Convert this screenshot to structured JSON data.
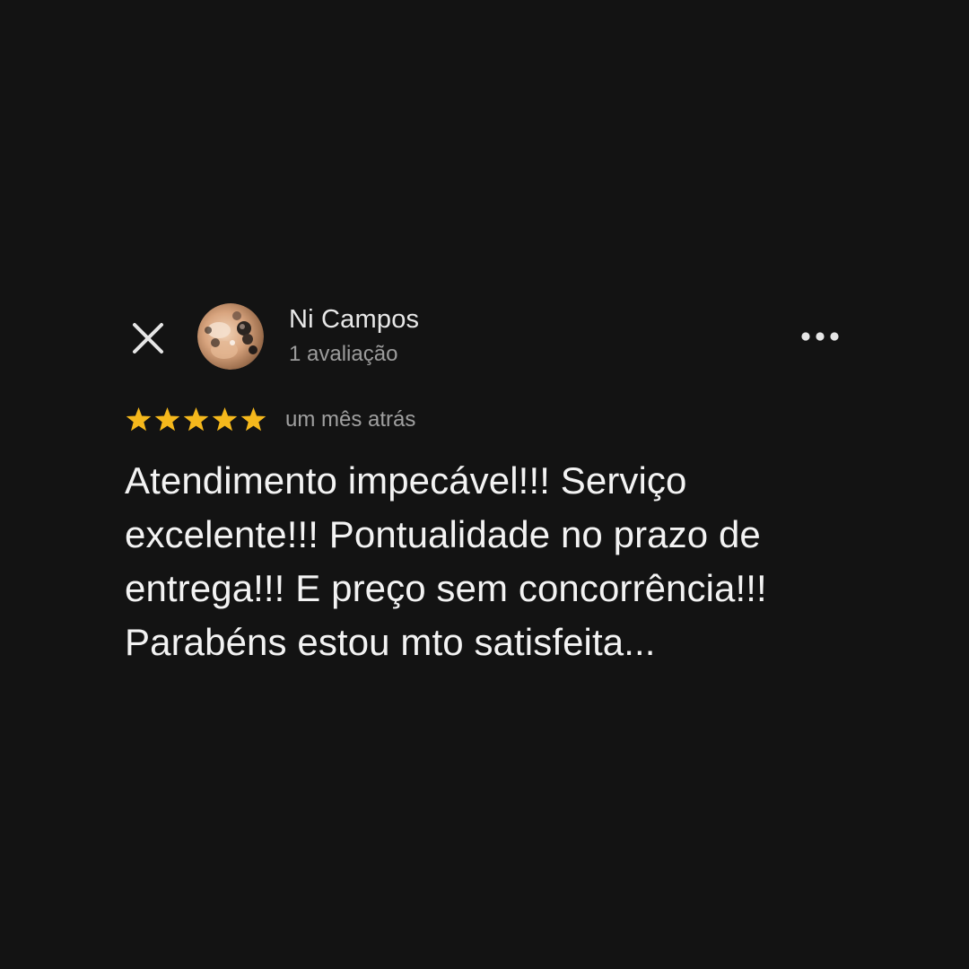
{
  "colors": {
    "background": "#131313",
    "star": "#f5b81c",
    "primary_text": "#f3f3f3",
    "secondary_text": "#9c9c9c"
  },
  "header": {
    "close_icon": "close-icon",
    "author_name": "Ni Campos",
    "author_meta": "1 avaliação",
    "more_icon": "more-options-icon"
  },
  "review": {
    "rating": 5,
    "rating_max": 5,
    "date": "um mês atrás",
    "text": "Atendimento impecável!!! Serviço excelente!!! Pontualidade no prazo de entrega!!! E preço sem concorrência!!! Parabéns estou mto satisfeita..."
  }
}
